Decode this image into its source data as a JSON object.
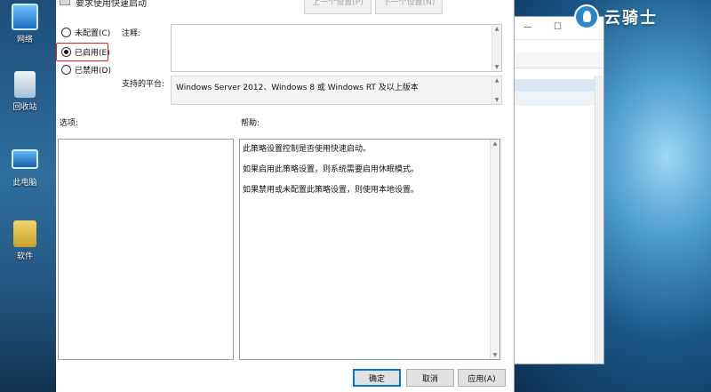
{
  "desktop": {
    "icons": [
      {
        "label": "网络",
        "icon": "network-icon"
      },
      {
        "label": "回收站",
        "icon": "recycle-bin-icon"
      },
      {
        "label": "此电脑",
        "icon": "this-pc-icon"
      },
      {
        "label": "软件",
        "icon": "software-folder-icon"
      }
    ],
    "watermark": "云骑士"
  },
  "dialog": {
    "title": "要求使用快速启动",
    "nav": {
      "prev": "上一个设置(P)",
      "next": "下一个设置(N)"
    },
    "state_options": [
      {
        "label": "未配置(C)",
        "selected": false
      },
      {
        "label": "已启用(E)",
        "selected": true
      },
      {
        "label": "已禁用(D)",
        "selected": false
      }
    ],
    "comment_label": "注释:",
    "comment_value": "",
    "platform_label": "支持的平台:",
    "platform_value": "Windows Server 2012、Windows 8 或 Windows RT 及以上版本",
    "options_label": "选项:",
    "help_label": "帮助:",
    "help_lines": [
      "此策略设置控制是否使用快速启动。",
      "如果启用此策略设置，则系统需要启用休眠模式。",
      "如果禁用或未配置此策略设置，则使用本地设置。"
    ],
    "buttons": {
      "ok": "确定",
      "cancel": "取消",
      "apply": "应用(A)"
    }
  },
  "background_window": {
    "controls": {
      "minimize": "—",
      "maximize": "☐"
    }
  },
  "colors": {
    "highlight": "#e02020",
    "primary_border": "#0078d7"
  }
}
